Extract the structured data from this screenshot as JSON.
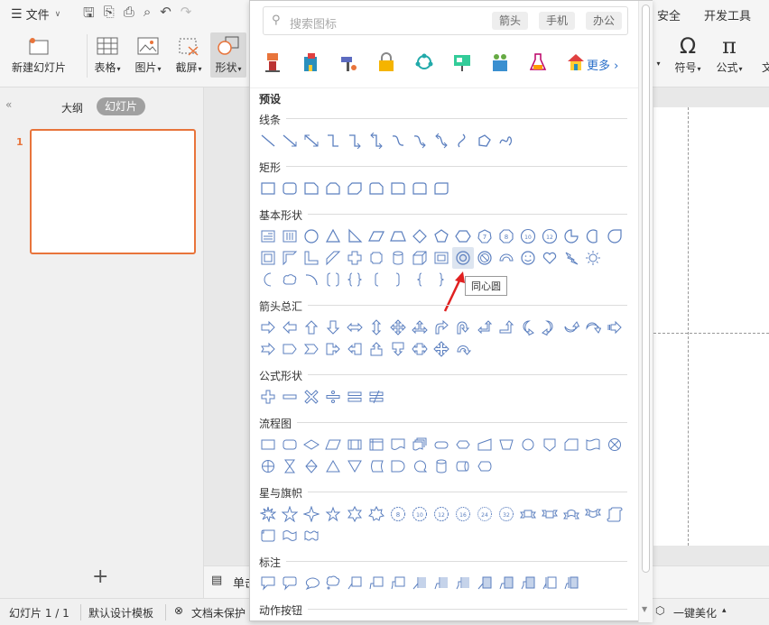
{
  "menubar": {
    "file_label": "文件",
    "tab_security": "安全",
    "tab_developer": "开发工具"
  },
  "ribbon": {
    "new_slide": "新建幻灯片",
    "table": "表格",
    "picture": "图片",
    "screenshot": "截屏",
    "shape": "形状",
    "symbol": "符号",
    "formula": "公式",
    "cut_label": "文"
  },
  "left_panel": {
    "outline_tab": "大纲",
    "slides_tab": "幻灯片",
    "slide_number": "1"
  },
  "notes_label": "单击",
  "status": {
    "slide_count": "幻灯片 1 / 1",
    "template": "默认设计模板",
    "doc_protect": "文档未保护",
    "beautify": "一键美化"
  },
  "dropdown": {
    "search_placeholder": "搜索图标",
    "tags": [
      "箭头",
      "手机",
      "办公"
    ],
    "more_label": "更多",
    "preset_title": "预设",
    "sections": {
      "lines": "线条",
      "rect": "矩形",
      "basic": "基本形状",
      "arrows": "箭头总汇",
      "formula": "公式形状",
      "flowchart": "流程图",
      "stars": "星与旗帜",
      "callouts": "标注",
      "action": "动作按钮"
    },
    "tooltip": "同心圆"
  },
  "colors": {
    "accent": "#e8743b",
    "shape_stroke": "#5b7fbf",
    "tooltip_arrow": "#e02020"
  }
}
